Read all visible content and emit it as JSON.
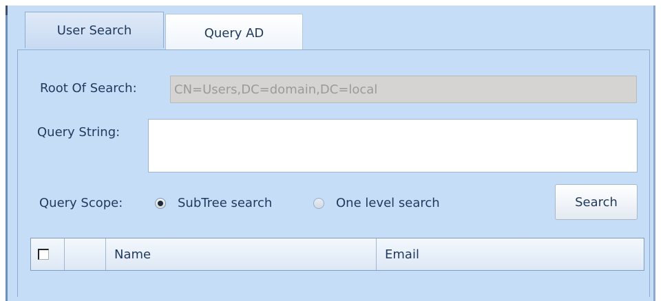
{
  "tabs": [
    {
      "label": "User Search",
      "active": false
    },
    {
      "label": "Query AD",
      "active": true
    }
  ],
  "form": {
    "root_label": "Root Of Search:",
    "root_value": "CN=Users,DC=domain,DC=local",
    "query_label": "Query String:",
    "query_value": "",
    "scope_label": "Query Scope:",
    "scope_options": [
      {
        "label": "SubTree search",
        "selected": true
      },
      {
        "label": "One level search",
        "selected": false
      }
    ],
    "search_button": "Search"
  },
  "grid": {
    "columns": [
      "",
      "",
      "Name",
      "Email"
    ],
    "select_all_checked": false
  },
  "colors": {
    "panel_bg": "#c6ddf7",
    "text": "#1e395b",
    "disabled_field_bg": "#d5d4d2"
  }
}
